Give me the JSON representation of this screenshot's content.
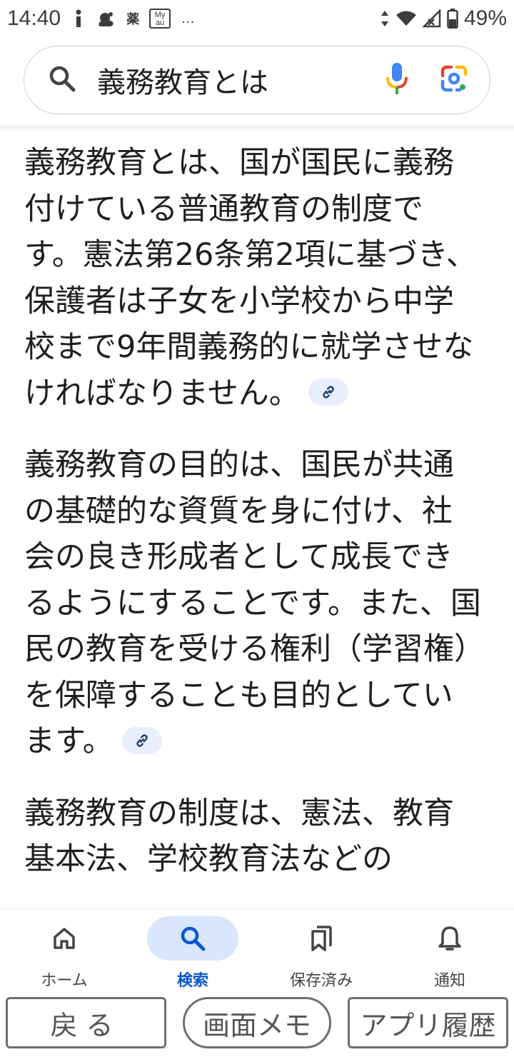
{
  "status_bar": {
    "time": "14:40",
    "icons": [
      "info-icon",
      "weather-icon",
      "medicine-app-icon",
      "my-au-icon",
      "more-dots-icon"
    ],
    "medicine_label": "薬",
    "my_au_label": "My au",
    "more_label": "…",
    "battery_text": "49%"
  },
  "search": {
    "query": "義務教育とは"
  },
  "content": {
    "paragraphs": [
      "義務教育とは、国が国民に義務付けている普通教育の制度です。憲法第26条第2項に基づき、保護者は子女を小学校から中学校まで9年間義務的に就学させなければなりません。",
      "義務教育の目的は、国民が共通の基礎的な資質を身に付け、社会の良き形成者として成長できるようにすることです。また、国民の教育を受ける権利（学習権）を保障することも目的としています。",
      "義務教育の制度は、憲法、教育基本法、学校教育法などの"
    ]
  },
  "bottom_nav": {
    "items": [
      {
        "label": "ホーム",
        "icon": "home-icon",
        "active": false
      },
      {
        "label": "検索",
        "icon": "search-icon",
        "active": true
      },
      {
        "label": "保存済み",
        "icon": "bookmarks-icon",
        "active": false
      },
      {
        "label": "通知",
        "icon": "bell-icon",
        "active": false
      }
    ]
  },
  "system_buttons": {
    "back": "戻る",
    "memo": "画面メモ",
    "history": "アプリ履歴"
  },
  "colors": {
    "accent": "#0b57d0",
    "active_pill": "#d8e6fe",
    "link_chip": "#e8eefc",
    "mic_blue": "#4285f4",
    "mic_red": "#ea4335",
    "mic_yellow": "#fbbc04",
    "mic_green": "#34a853"
  }
}
